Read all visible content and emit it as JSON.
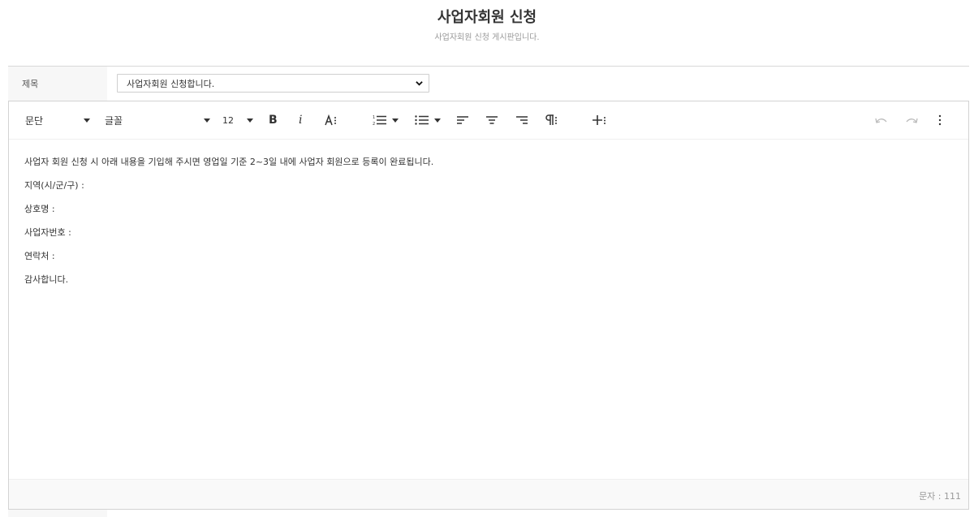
{
  "header": {
    "title": "사업자회원 신청",
    "subtitle": "사업자회원 신청 게시판입니다."
  },
  "form": {
    "subject_label": "제목",
    "subject_value": "사업자회원 신청합니다."
  },
  "toolbar": {
    "paragraph": "문단",
    "font": "글꼴",
    "font_size": "12",
    "bold": "B",
    "italic": "i"
  },
  "content": {
    "lines": [
      "사업자 회원 신청 시 아래 내용을 기입해 주시면 영업일 기준 2~3일 내에 사업자 회원으로 등록이 완료됩니다.",
      "지역(시/군/구) :",
      "상호명 :",
      "사업자번호 :",
      "연락처 :",
      "감사합니다."
    ]
  },
  "footer": {
    "char_count": "문자 : 111"
  },
  "colors": {
    "border": "#d3d3d3",
    "label_bg": "#f7f7f7",
    "muted_text": "#999999"
  }
}
